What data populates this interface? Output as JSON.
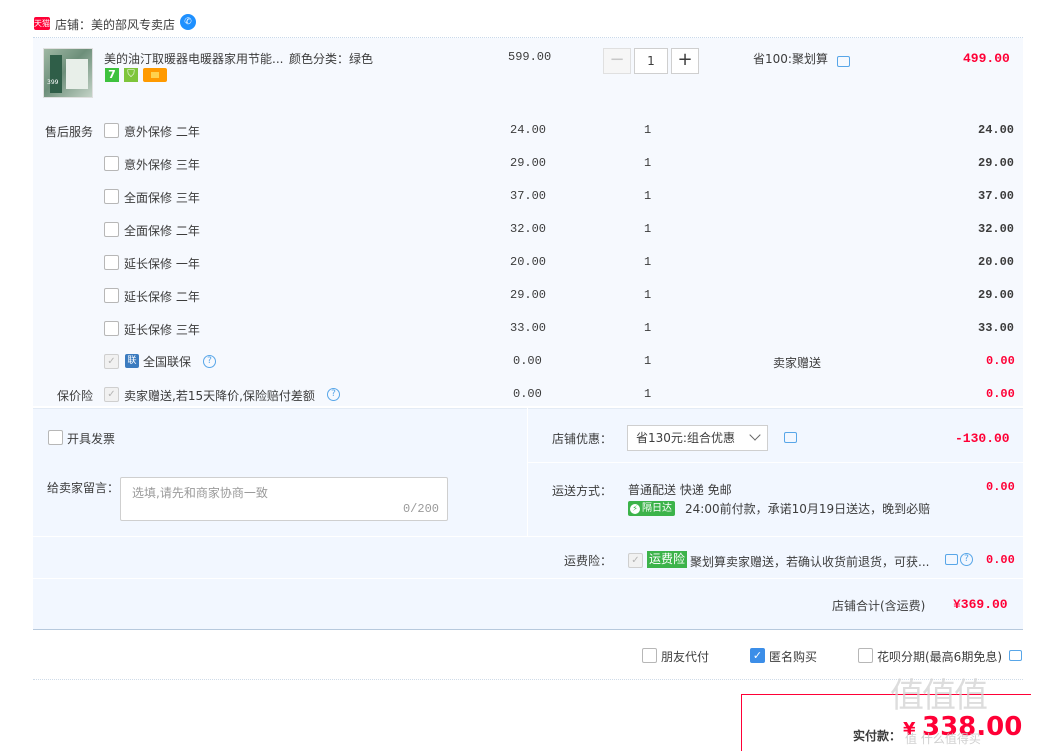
{
  "shop": {
    "badge": "天猫",
    "name": "店铺：美的部风专卖店",
    "ww_icon": "wangwang-icon"
  },
  "item": {
    "title": "美的油汀取暖器电暖器家用节能...",
    "spec": "颜色分类：绿色",
    "unit_price": "599.00",
    "quantity": "1",
    "promo": "省100:聚划算",
    "subtotal": "499.00",
    "thumb_text": "399"
  },
  "services": {
    "label": "售后服务",
    "rows": [
      {
        "name": "意外保修 二年",
        "price": "24.00",
        "qty": "1",
        "total": "24.00"
      },
      {
        "name": "意外保修 三年",
        "price": "29.00",
        "qty": "1",
        "total": "29.00"
      },
      {
        "name": "全面保修 三年",
        "price": "37.00",
        "qty": "1",
        "total": "37.00"
      },
      {
        "name": "全面保修 二年",
        "price": "32.00",
        "qty": "1",
        "total": "32.00"
      },
      {
        "name": "延长保修 一年",
        "price": "20.00",
        "qty": "1",
        "total": "20.00"
      },
      {
        "name": "延长保修 二年",
        "price": "29.00",
        "qty": "1",
        "total": "29.00"
      },
      {
        "name": "延长保修 三年",
        "price": "33.00",
        "qty": "1",
        "total": "33.00"
      }
    ],
    "lianbao": {
      "icon": "联",
      "name": "全国联保",
      "price": "0.00",
      "qty": "1",
      "note": "卖家赠送",
      "total": "0.00"
    }
  },
  "price_protect": {
    "label": "保价险",
    "name": "卖家赠送,若15天降价,保险赔付差额",
    "price": "0.00",
    "qty": "1",
    "total": "0.00"
  },
  "invoice": {
    "label": "开具发票"
  },
  "shop_discount": {
    "label": "店铺优惠：",
    "selected": "省130元:组合优惠",
    "amount": "-130.00"
  },
  "message": {
    "label": "给卖家留言：",
    "placeholder": "选填,请先和商家协商一致",
    "count": "0/200"
  },
  "shipping": {
    "label": "运送方式：",
    "method": "普通配送 快递 免邮",
    "tag": "隔日达",
    "note": "24:00前付款，承诺10月19日送达，晚到必赔",
    "amount": "0.00"
  },
  "freight_insurance": {
    "label": "运费险：",
    "tag": "运费险",
    "desc": "聚划算卖家赠送，若确认收货前退货，可获...",
    "amount": "0.00"
  },
  "shop_total": {
    "label": "店铺合计(含运费)",
    "amount": "¥369.00"
  },
  "options": {
    "friend_pay": "朋友代付",
    "anonymous": "匿名购买",
    "huabei": "花呗分期(最高6期免息)"
  },
  "payment": {
    "label": "实付款：",
    "currency": "¥",
    "amount": "338.00"
  },
  "watermark": {
    "logo": "值值值",
    "site": "值 什么值得买"
  },
  "colors": {
    "price_red": "#ff0036",
    "link_blue": "#3c8ee8",
    "green_tag": "#3cb34a",
    "panel_bg": "#f6f9fe"
  }
}
